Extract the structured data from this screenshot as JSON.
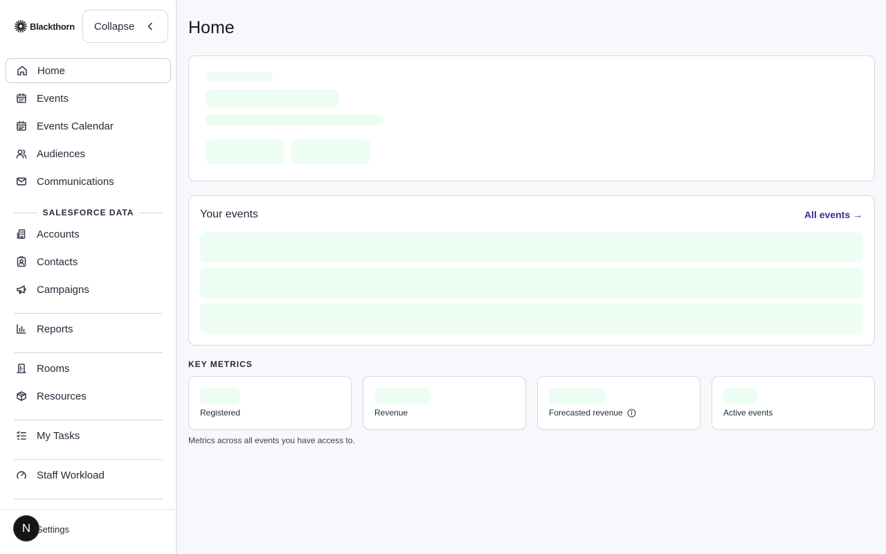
{
  "brand": {
    "name": "Blackthorn"
  },
  "sidebar": {
    "collapse_label": "Collapse",
    "items": [
      {
        "label": "Home",
        "icon": "home-icon"
      },
      {
        "label": "Events",
        "icon": "calendar-icon"
      },
      {
        "label": "Events Calendar",
        "icon": "calendar-grid-icon"
      },
      {
        "label": "Audiences",
        "icon": "users-icon"
      },
      {
        "label": "Communications",
        "icon": "mail-icon"
      }
    ],
    "section_label": "SALESFORCE DATA",
    "salesforce_items": [
      {
        "label": "Accounts",
        "icon": "building-icon"
      },
      {
        "label": "Contacts",
        "icon": "contact-card-icon"
      },
      {
        "label": "Campaigns",
        "icon": "megaphone-icon"
      }
    ],
    "reports_label": "Reports",
    "rooms_label": "Rooms",
    "resources_label": "Resources",
    "tasks_label": "My Tasks",
    "workload_label": "Staff Workload",
    "settings_label": "Settings",
    "avatar_initial": "N"
  },
  "main": {
    "title": "Home",
    "events_card": {
      "title": "Your events",
      "link": "All events →"
    },
    "key_metrics_label": "KEY METRICS",
    "metrics": [
      {
        "label": "Registered"
      },
      {
        "label": "Revenue"
      },
      {
        "label": "Forecasted revenue"
      },
      {
        "label": "Active events"
      }
    ],
    "metrics_note": "Metrics across all events you have access to."
  },
  "colors": {
    "skeleton": "#edfdf3",
    "link": "#3b2b99",
    "avatar": "#151515"
  }
}
